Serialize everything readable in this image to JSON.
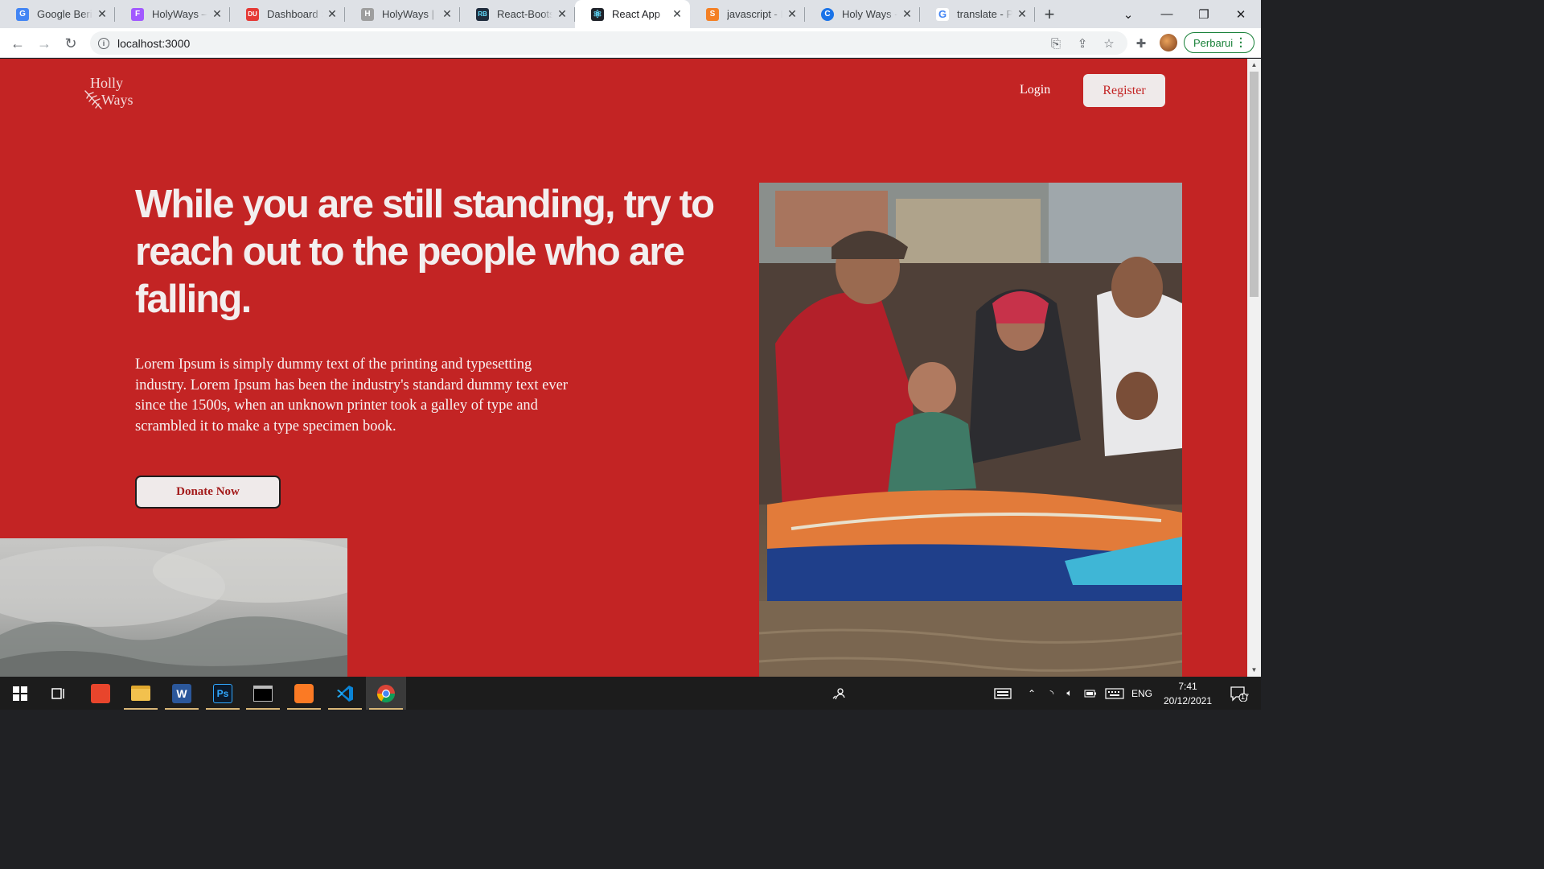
{
  "browser": {
    "tabs": [
      {
        "label": "Google Berita",
        "favicon_color": "#4285f4",
        "favicon_text": "G"
      },
      {
        "label": "HolyWays – Figma",
        "favicon_color": "#a259ff",
        "favicon_text": "F"
      },
      {
        "label": "Dashboard Sistem",
        "favicon_color": "#e53935",
        "favicon_text": "DU"
      },
      {
        "label": "HolyWays | Co",
        "favicon_color": "#9e9e9e",
        "favicon_text": "H"
      },
      {
        "label": "React-Bootstrap",
        "favicon_color": "#1e2b3c",
        "favicon_text": "RB"
      },
      {
        "label": "React App",
        "favicon_color": "#20232a",
        "favicon_text": "⚛"
      },
      {
        "label": "javascript - Re",
        "favicon_color": "#f48024",
        "favicon_text": "S"
      },
      {
        "label": "Holy Ways - P",
        "favicon_color": "#1a73e8",
        "favicon_text": "C"
      },
      {
        "label": "translate - Par",
        "favicon_color": "#ffffff",
        "favicon_text": "G"
      }
    ],
    "active_tab_index": 5,
    "url": "localhost:3000",
    "update_button": "Perbarui"
  },
  "site": {
    "logo_line1": "Holly",
    "logo_line2": "Ways",
    "nav": {
      "login": "Login",
      "register": "Register"
    },
    "hero": {
      "headline": "While you are still standing, try to reach out to the people who are falling.",
      "lead": "Lorem Ipsum is simply dummy text of the printing and typesetting industry. Lorem Ipsum has been the industry's standard dummy text ever since the 1500s, when an unknown printer took a galley of type and scrambled it to make a type specimen book.",
      "cta": "Donate Now"
    },
    "colors": {
      "brand_red": "#c32424",
      "button_bg": "#efeaea"
    }
  },
  "taskbar": {
    "apps": [
      "windows-start-icon",
      "task-view-icon",
      "app-red-icon",
      "file-explorer-icon",
      "word-icon",
      "photoshop-icon",
      "terminal-icon",
      "xampp-icon",
      "vscode-icon",
      "chrome-icon"
    ],
    "language": "ENG",
    "time": "7:41",
    "date": "20/12/2021",
    "notifications": "17"
  }
}
